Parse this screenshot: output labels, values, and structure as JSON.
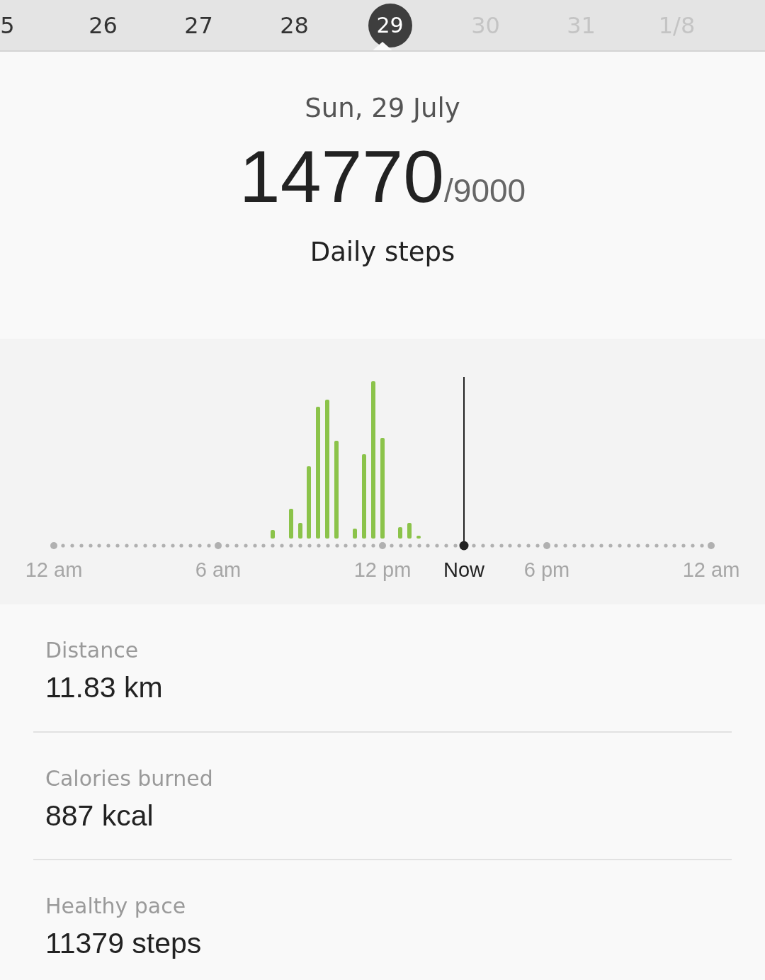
{
  "date_strip": [
    {
      "label": "5",
      "selected": false,
      "future": false
    },
    {
      "label": "26",
      "selected": false,
      "future": false
    },
    {
      "label": "27",
      "selected": false,
      "future": false
    },
    {
      "label": "28",
      "selected": false,
      "future": false
    },
    {
      "label": "29",
      "selected": true,
      "future": false
    },
    {
      "label": "30",
      "selected": false,
      "future": true
    },
    {
      "label": "31",
      "selected": false,
      "future": true
    },
    {
      "label": "1/8",
      "selected": false,
      "future": true
    }
  ],
  "date": "Sun, 29 July",
  "steps": "14770",
  "goal": "/9000",
  "steps_label": "Daily steps",
  "chart": {
    "axis_labels": [
      {
        "label": "12 am",
        "kind": "tick"
      },
      {
        "label": "6 am",
        "kind": "tick"
      },
      {
        "label": "12 pm",
        "kind": "tick"
      },
      {
        "label": "Now",
        "kind": "now"
      },
      {
        "label": "6 pm",
        "kind": "tick"
      },
      {
        "label": "12 am",
        "kind": "tick"
      }
    ]
  },
  "stats": [
    {
      "label": "Distance",
      "value": "11.83 km"
    },
    {
      "label": "Calories burned",
      "value": "887 kcal"
    },
    {
      "label": "Healthy pace",
      "value": "11379 steps"
    }
  ]
}
